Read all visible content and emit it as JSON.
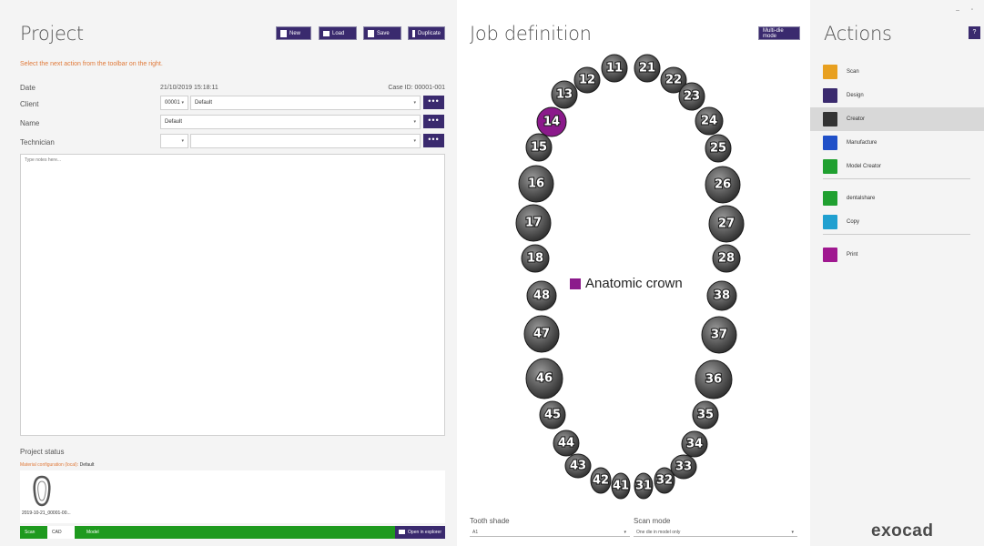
{
  "project": {
    "title": "Project",
    "buttons": {
      "new": "New",
      "load": "Load",
      "save": "Save",
      "duplicate": "Duplicate"
    },
    "hint": "Select the next action from the toolbar on the right.",
    "date_label": "Date",
    "date_value": "21/10/2019 15:18:11",
    "case_id": "Case ID: 00001-001",
    "client_label": "Client",
    "client_code": "00001",
    "client_name": "Default",
    "name_label": "Name",
    "name_value": "Default",
    "technician_label": "Technician",
    "more": "•••",
    "notes_placeholder": "Type notes here...",
    "status_label": "Project status",
    "material_label": "Material configuration (local):",
    "material_value": "Default",
    "thumb_caption": "2019-10-21_00001-00...",
    "crumbs": [
      "Scan",
      "CAD",
      "Model"
    ],
    "open_explorer": "Open in explorer"
  },
  "job": {
    "title": "Job definition",
    "multi_die": "Multi-die mode",
    "legend": "Anatomic crown",
    "legend_color": "#8b1a8b",
    "selected_tooth": "14",
    "teeth": [
      "11",
      "12",
      "13",
      "14",
      "15",
      "16",
      "17",
      "18",
      "21",
      "22",
      "23",
      "24",
      "25",
      "26",
      "27",
      "28",
      "31",
      "32",
      "33",
      "34",
      "35",
      "36",
      "37",
      "38",
      "41",
      "42",
      "43",
      "44",
      "45",
      "46",
      "47",
      "48"
    ],
    "tooth_shade_label": "Tooth shade",
    "tooth_shade_value": "A1",
    "scan_mode_label": "Scan mode",
    "scan_mode_value": "One die in model only"
  },
  "actions": {
    "title": "Actions",
    "help": "?",
    "items": [
      {
        "label": "Scan",
        "icon": "scan-icon",
        "color": "#e8a020"
      },
      {
        "label": "Design",
        "icon": "design-icon",
        "color": "#3a2a6e"
      },
      {
        "label": "Creator",
        "icon": "creator-icon",
        "color": "#333333"
      },
      {
        "label": "Manufacture",
        "icon": "manufacture-icon",
        "color": "#2050c8"
      },
      {
        "label": "Model Creator",
        "icon": "model-creator-icon",
        "color": "#20a030"
      },
      {
        "label": "dentalshare",
        "icon": "dentalshare-icon",
        "color": "#20a030"
      },
      {
        "label": "Copy",
        "icon": "copy-icon",
        "color": "#20a0d0"
      },
      {
        "label": "Print",
        "icon": "print-icon",
        "color": "#a01890"
      }
    ],
    "brand": "exocad"
  }
}
